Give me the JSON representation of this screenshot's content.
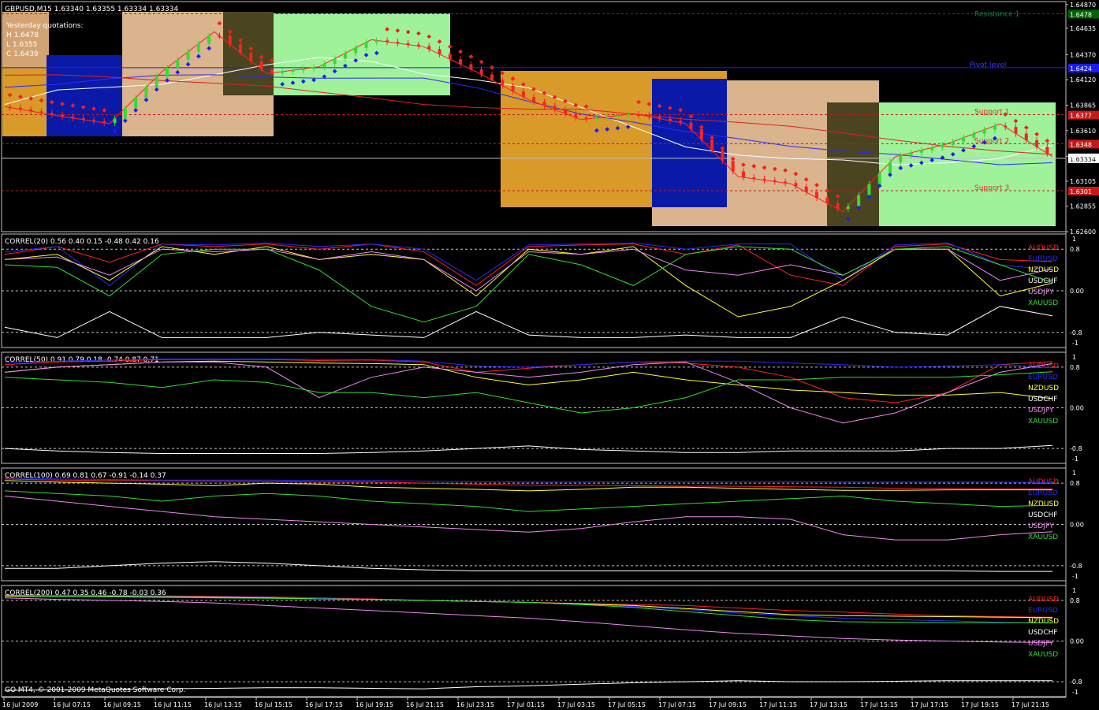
{
  "main": {
    "header": "GBPUSD,M15  1.63340 1.63355 1.63334 1.63334",
    "yesterday": [
      "Yesterday quotations:",
      "H 1.6478",
      "L 1.6355",
      "C 1.6439"
    ],
    "yaxis": [
      "1.64870",
      "1.64635",
      "1.64370",
      "1.64120",
      "1.63865",
      "1.63610",
      "1.63355",
      "1.63105",
      "1.62855",
      "1.62600"
    ],
    "levels": [
      {
        "label": "Resistance 1",
        "price": 1.6478,
        "color": "#0f6a2a",
        "tag": "1.6478",
        "tag_bg": "#006400"
      },
      {
        "label": "Pivot level",
        "price": 1.6424,
        "color": "#1a1aff",
        "tag": "1.6424",
        "tag_bg": "#1a1aff"
      },
      {
        "label": "Support 1",
        "price": 1.6377,
        "color": "#c81818",
        "tag": "1.6377",
        "tag_bg": "#c81818"
      },
      {
        "label": "Support 2",
        "price": 1.6348,
        "color": "#c81818",
        "tag": "1.6348",
        "tag_bg": "#c81818"
      },
      {
        "label": "Support 3",
        "price": 1.6301,
        "color": "#c81818",
        "tag": "1.6301",
        "tag_bg": "#c81818"
      }
    ],
    "current_price": "1.63334",
    "fib_tag": "1.6478"
  },
  "panels": [
    {
      "title": "CORREL(20) 0.56 0.40 0.15 -0.48 0.42 0.16",
      "ticks": [
        "1",
        "0.8",
        "0.00",
        "-0.8",
        "-1"
      ]
    },
    {
      "title": "CORREL(50) 0.91 0.79 0.18 -0.74 0.87 0.71",
      "ticks": [
        "1",
        "0.8",
        "0.00",
        "-0.8",
        "-1"
      ]
    },
    {
      "title": "CORREL(100) 0.69 0.81 0.67 -0.91 -0.14 0.37",
      "ticks": [
        "1",
        "0.8",
        "0.00",
        "-0.8",
        "-1"
      ]
    },
    {
      "title": "CORREL(200) 0.47 0.35 0.46 -0.78 -0.03 0.36",
      "ticks": [
        "1",
        "0.8",
        "0.00",
        "-0.8",
        "-1"
      ]
    }
  ],
  "legend": [
    {
      "name": "AUDUSD",
      "color": "#ff2020"
    },
    {
      "name": "EURUSD",
      "color": "#2a2aff"
    },
    {
      "name": "NZDUSD",
      "color": "#ffff30"
    },
    {
      "name": "USDCHF",
      "color": "#ffffff"
    },
    {
      "name": "USDJPY",
      "color": "#ee88ee"
    },
    {
      "name": "XAUUSD",
      "color": "#33dd33"
    }
  ],
  "copyright": "GO MT4, © 2001-2009 MetaQuotes Software Corp.",
  "time_labels": [
    "16 Jul 2009",
    "16 Jul 07:15",
    "16 Jul 09:15",
    "16 Jul 11:15",
    "16 Jul 13:15",
    "16 Jul 15:15",
    "16 Jul 17:15",
    "16 Jul 19:15",
    "16 Jul 21:15",
    "16 Jul 23:15",
    "17 Jul 01:15",
    "17 Jul 03:15",
    "17 Jul 05:15",
    "17 Jul 07:15",
    "17 Jul 09:15",
    "17 Jul 11:15",
    "17 Jul 13:15",
    "17 Jul 15:15",
    "17 Jul 17:15",
    "17 Jul 19:15",
    "17 Jul 21:15"
  ],
  "chart_data": [
    {
      "type": "line",
      "title": "GBPUSD,M15  1.63340 1.63355 1.63334 1.63334",
      "ylim": [
        1.626,
        1.6487
      ],
      "x": [
        "16 Jul 2009",
        "16 Jul 07:15",
        "16 Jul 09:15",
        "16 Jul 11:15",
        "16 Jul 13:15",
        "16 Jul 15:15",
        "16 Jul 17:15",
        "16 Jul 19:15",
        "16 Jul 21:15",
        "16 Jul 23:15",
        "17 Jul 01:15",
        "17 Jul 03:15",
        "17 Jul 05:15",
        "17 Jul 07:15",
        "17 Jul 09:15",
        "17 Jul 11:15",
        "17 Jul 13:15",
        "17 Jul 15:15",
        "17 Jul 17:15",
        "17 Jul 19:15",
        "17 Jul 21:15"
      ],
      "series": [
        {
          "values": [
            1.6385,
            1.6376,
            1.6368,
            1.642,
            1.646,
            1.6418,
            1.6425,
            1.6452,
            1.6445,
            1.642,
            1.6392,
            1.6372,
            1.6378,
            1.6368,
            1.6315,
            1.6308,
            1.628,
            1.6335,
            1.6348,
            1.6368,
            1.6335
          ]
        }
      ]
    },
    {
      "type": "line",
      "title": "CORREL(20) 0.56 0.40 0.15 -0.48 0.42 0.16",
      "ylim": [
        -1,
        1
      ],
      "series": [
        {
          "name": "AUDUSD",
          "values": [
            0.7,
            0.85,
            0.55,
            0.9,
            0.85,
            0.9,
            0.8,
            0.9,
            0.75,
            0.1,
            0.85,
            0.88,
            0.9,
            0.7,
            0.88,
            0.3,
            0.1,
            0.85,
            0.9,
            0.6,
            0.56
          ]
        },
        {
          "name": "EURUSD",
          "values": [
            0.75,
            0.85,
            0.1,
            0.9,
            0.88,
            0.92,
            0.85,
            0.9,
            0.8,
            0.2,
            0.88,
            0.9,
            0.92,
            0.8,
            0.9,
            0.9,
            0.2,
            0.88,
            0.92,
            0.5,
            0.4
          ]
        },
        {
          "name": "NZDUSD",
          "values": [
            0.6,
            0.7,
            0.2,
            0.85,
            0.7,
            0.85,
            0.6,
            0.7,
            0.6,
            -0.1,
            0.8,
            0.7,
            0.85,
            0.1,
            -0.5,
            -0.3,
            0.2,
            0.8,
            0.8,
            -0.1,
            0.15
          ]
        },
        {
          "name": "USDCHF",
          "values": [
            -0.7,
            -0.9,
            -0.4,
            -0.9,
            -0.9,
            -0.9,
            -0.8,
            -0.85,
            -0.9,
            -0.4,
            -0.85,
            -0.9,
            -0.9,
            -0.85,
            -0.9,
            -0.9,
            -0.5,
            -0.8,
            -0.85,
            -0.3,
            -0.48
          ]
        },
        {
          "name": "USDJPY",
          "values": [
            0.6,
            0.65,
            0.3,
            0.8,
            0.75,
            0.8,
            0.6,
            0.75,
            0.6,
            0.0,
            0.75,
            0.7,
            0.8,
            0.4,
            0.3,
            0.5,
            0.3,
            0.8,
            0.8,
            0.2,
            0.42
          ]
        },
        {
          "name": "XAUUSD",
          "values": [
            0.5,
            0.45,
            -0.1,
            0.7,
            0.8,
            0.8,
            0.4,
            -0.3,
            -0.6,
            -0.3,
            0.7,
            0.5,
            0.1,
            0.7,
            0.85,
            0.8,
            0.3,
            0.8,
            0.85,
            0.5,
            0.16
          ]
        }
      ]
    },
    {
      "type": "line",
      "title": "CORREL(50) 0.91 0.79 0.18 -0.74 0.87 0.71",
      "ylim": [
        -1,
        1
      ],
      "series": [
        {
          "name": "AUDUSD",
          "values": [
            0.85,
            0.9,
            0.92,
            0.95,
            0.95,
            0.95,
            0.93,
            0.94,
            0.9,
            0.7,
            0.78,
            0.85,
            0.9,
            0.88,
            0.8,
            0.6,
            0.2,
            0.1,
            0.3,
            0.85,
            0.91
          ]
        },
        {
          "name": "EURUSD",
          "values": [
            0.88,
            0.92,
            0.94,
            0.96,
            0.96,
            0.96,
            0.95,
            0.95,
            0.92,
            0.82,
            0.8,
            0.85,
            0.9,
            0.92,
            0.92,
            0.88,
            0.85,
            0.8,
            0.82,
            0.85,
            0.79
          ]
        },
        {
          "name": "NZDUSD",
          "values": [
            0.7,
            0.8,
            0.85,
            0.9,
            0.92,
            0.9,
            0.88,
            0.87,
            0.85,
            0.6,
            0.45,
            0.55,
            0.7,
            0.55,
            0.45,
            0.35,
            0.3,
            0.25,
            0.25,
            0.3,
            0.18
          ]
        },
        {
          "name": "USDCHF",
          "values": [
            -0.8,
            -0.85,
            -0.88,
            -0.9,
            -0.9,
            -0.9,
            -0.9,
            -0.88,
            -0.85,
            -0.8,
            -0.75,
            -0.82,
            -0.85,
            -0.88,
            -0.88,
            -0.85,
            -0.85,
            -0.85,
            -0.8,
            -0.8,
            -0.74
          ]
        },
        {
          "name": "USDJPY",
          "values": [
            0.7,
            0.8,
            0.85,
            0.9,
            0.9,
            0.8,
            0.2,
            0.6,
            0.8,
            0.7,
            0.6,
            0.7,
            0.85,
            0.9,
            0.5,
            0.0,
            -0.3,
            -0.1,
            0.3,
            0.7,
            0.87
          ]
        },
        {
          "name": "XAUUSD",
          "values": [
            0.6,
            0.55,
            0.5,
            0.4,
            0.55,
            0.5,
            0.3,
            0.3,
            0.2,
            0.3,
            0.1,
            -0.1,
            0.0,
            0.2,
            0.55,
            0.55,
            0.6,
            0.6,
            0.6,
            0.65,
            0.71
          ]
        }
      ]
    },
    {
      "type": "line",
      "title": "CORREL(100) 0.69 0.81 0.67 -0.91 -0.14 0.37",
      "ylim": [
        -1,
        1
      ],
      "series": [
        {
          "name": "AUDUSD",
          "values": [
            0.88,
            0.86,
            0.85,
            0.85,
            0.84,
            0.83,
            0.82,
            0.82,
            0.8,
            0.78,
            0.76,
            0.76,
            0.75,
            0.74,
            0.74,
            0.73,
            0.72,
            0.7,
            0.7,
            0.69,
            0.69
          ]
        },
        {
          "name": "EURUSD",
          "values": [
            0.9,
            0.88,
            0.87,
            0.86,
            0.86,
            0.86,
            0.85,
            0.85,
            0.84,
            0.83,
            0.82,
            0.82,
            0.83,
            0.83,
            0.83,
            0.83,
            0.82,
            0.82,
            0.82,
            0.82,
            0.81
          ]
        },
        {
          "name": "NZDUSD",
          "values": [
            0.85,
            0.82,
            0.8,
            0.78,
            0.75,
            0.8,
            0.78,
            0.72,
            0.7,
            0.68,
            0.65,
            0.68,
            0.72,
            0.72,
            0.7,
            0.68,
            0.66,
            0.66,
            0.67,
            0.67,
            0.67
          ]
        },
        {
          "name": "USDCHF",
          "values": [
            -0.85,
            -0.85,
            -0.8,
            -0.75,
            -0.72,
            -0.75,
            -0.8,
            -0.85,
            -0.88,
            -0.9,
            -0.9,
            -0.9,
            -0.9,
            -0.9,
            -0.9,
            -0.9,
            -0.9,
            -0.9,
            -0.9,
            -0.91,
            -0.91
          ]
        },
        {
          "name": "USDJPY",
          "values": [
            0.55,
            0.45,
            0.35,
            0.25,
            0.15,
            0.1,
            0.05,
            0.0,
            -0.05,
            -0.1,
            -0.15,
            -0.08,
            0.05,
            0.15,
            0.15,
            0.1,
            -0.2,
            -0.3,
            -0.3,
            -0.2,
            -0.14
          ]
        },
        {
          "name": "XAUUSD",
          "values": [
            0.65,
            0.6,
            0.55,
            0.45,
            0.55,
            0.6,
            0.55,
            0.45,
            0.4,
            0.35,
            0.25,
            0.3,
            0.35,
            0.4,
            0.45,
            0.5,
            0.55,
            0.45,
            0.4,
            0.35,
            0.37
          ]
        }
      ]
    },
    {
      "type": "line",
      "title": "CORREL(200) 0.47 0.35 0.46 -0.78 -0.03 0.36",
      "ylim": [
        -1,
        1
      ],
      "series": [
        {
          "name": "AUDUSD",
          "values": [
            0.9,
            0.9,
            0.9,
            0.89,
            0.88,
            0.87,
            0.85,
            0.83,
            0.8,
            0.78,
            0.76,
            0.74,
            0.72,
            0.7,
            0.65,
            0.6,
            0.57,
            0.53,
            0.5,
            0.48,
            0.47
          ]
        },
        {
          "name": "EURUSD",
          "values": [
            0.9,
            0.89,
            0.89,
            0.88,
            0.87,
            0.86,
            0.84,
            0.82,
            0.8,
            0.78,
            0.76,
            0.72,
            0.68,
            0.62,
            0.55,
            0.5,
            0.45,
            0.42,
            0.4,
            0.37,
            0.35
          ]
        },
        {
          "name": "NZDUSD",
          "values": [
            0.88,
            0.88,
            0.88,
            0.87,
            0.86,
            0.85,
            0.83,
            0.82,
            0.8,
            0.78,
            0.76,
            0.73,
            0.7,
            0.64,
            0.58,
            0.52,
            0.5,
            0.49,
            0.48,
            0.47,
            0.46
          ]
        },
        {
          "name": "USDCHF",
          "values": [
            -0.97,
            -0.96,
            -0.95,
            -0.94,
            -0.93,
            -0.92,
            -0.92,
            -0.93,
            -0.94,
            -0.9,
            -0.88,
            -0.85,
            -0.82,
            -0.8,
            -0.78,
            -0.8,
            -0.8,
            -0.79,
            -0.78,
            -0.78,
            -0.78
          ]
        },
        {
          "name": "USDJPY",
          "values": [
            0.85,
            0.82,
            0.8,
            0.78,
            0.75,
            0.7,
            0.65,
            0.6,
            0.55,
            0.5,
            0.45,
            0.38,
            0.3,
            0.22,
            0.15,
            0.1,
            0.05,
            0.02,
            0.0,
            -0.02,
            -0.03
          ]
        },
        {
          "name": "XAUUSD",
          "values": [
            0.9,
            0.88,
            0.87,
            0.86,
            0.85,
            0.84,
            0.83,
            0.82,
            0.8,
            0.78,
            0.76,
            0.72,
            0.66,
            0.58,
            0.5,
            0.42,
            0.38,
            0.37,
            0.36,
            0.36,
            0.36
          ]
        }
      ]
    }
  ]
}
